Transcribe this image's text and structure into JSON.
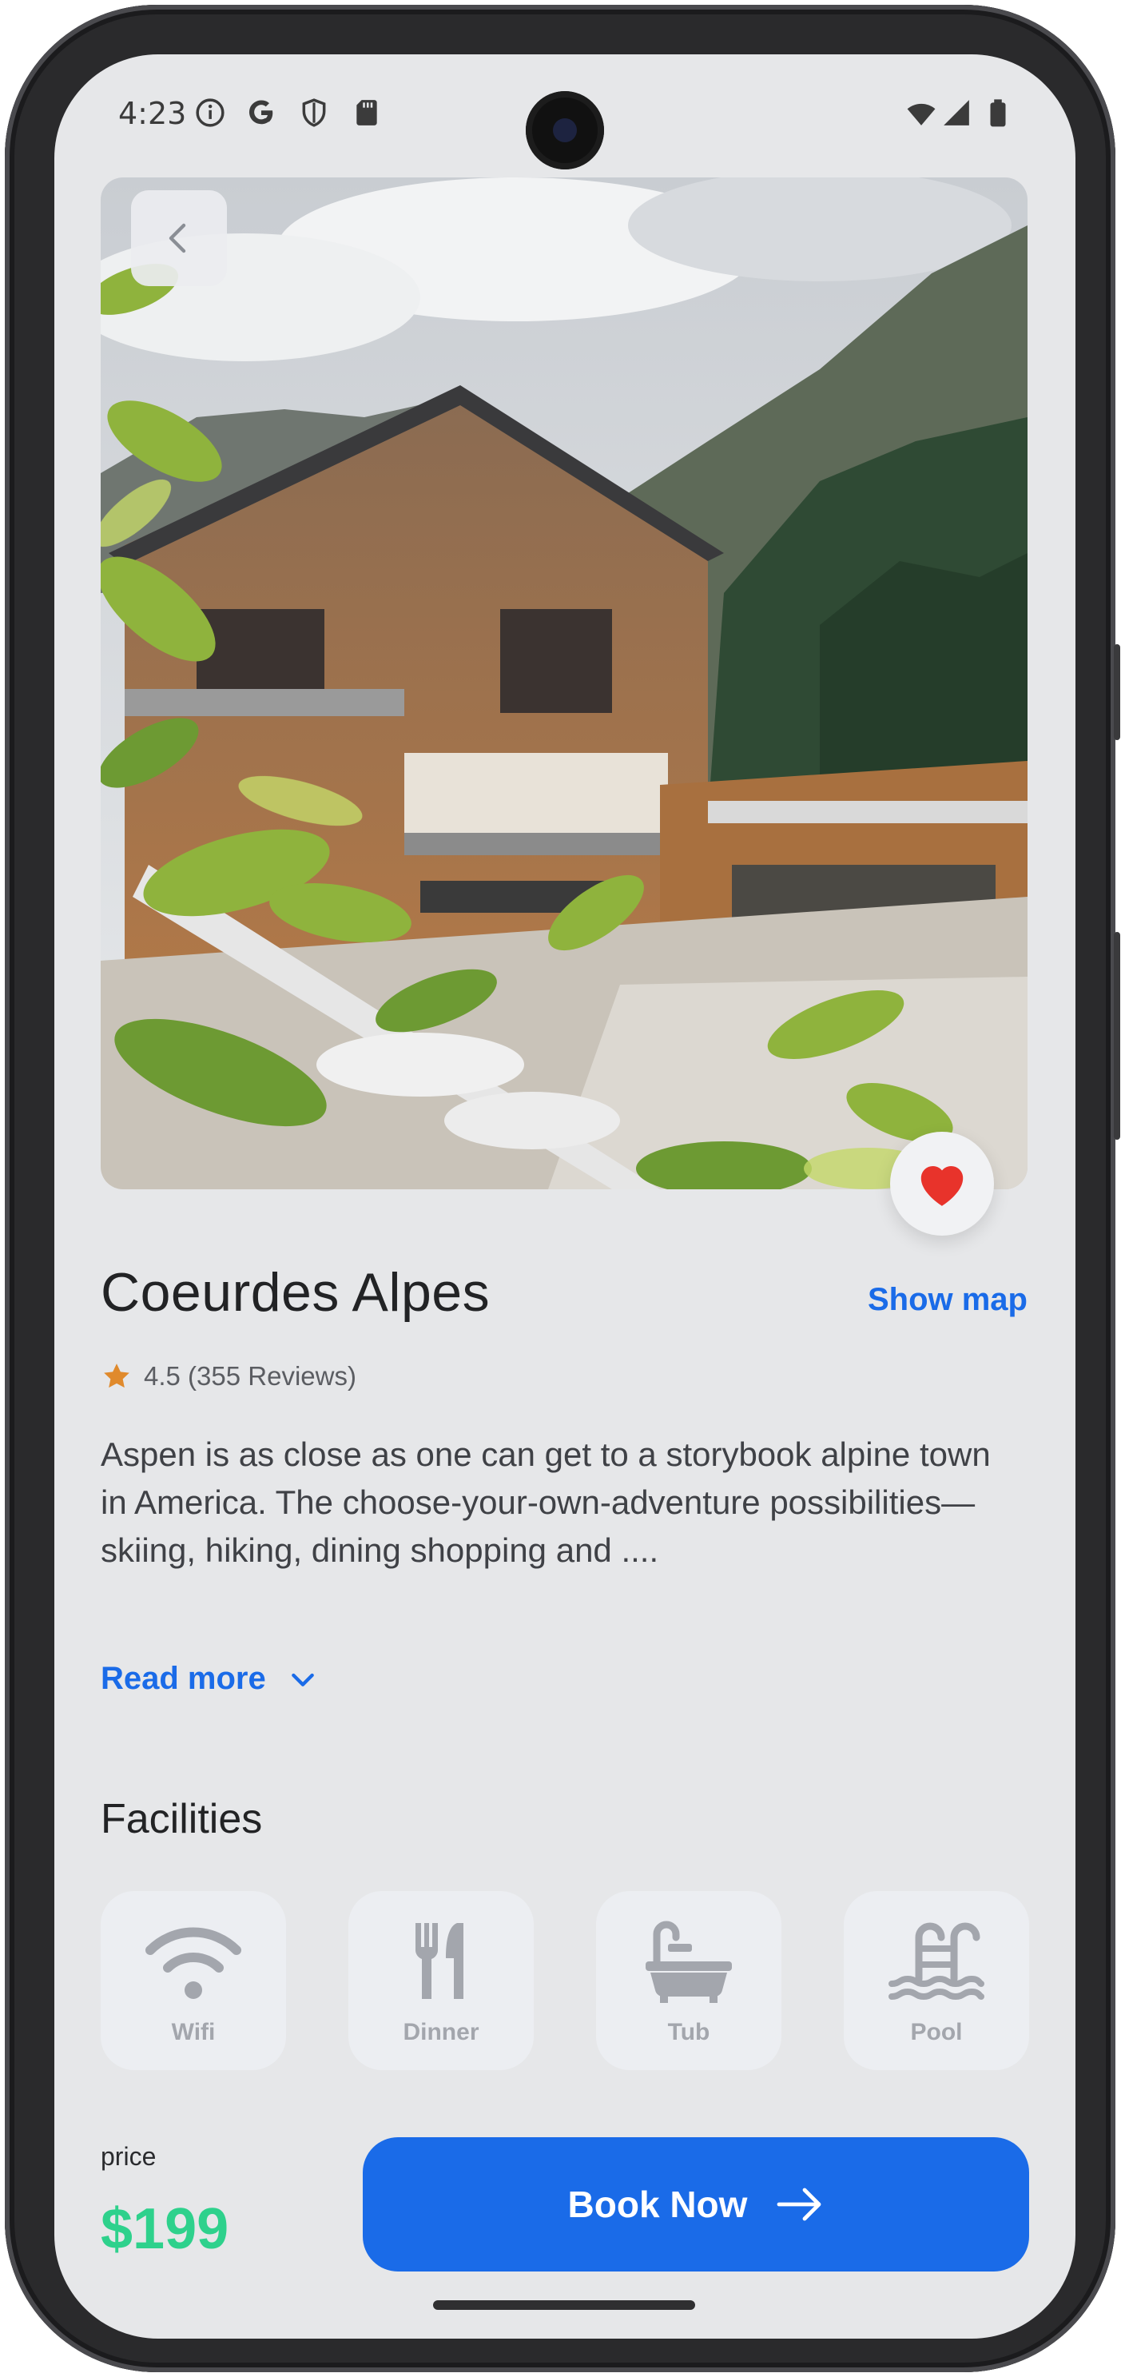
{
  "status_bar": {
    "time": "4:23",
    "left_icons": [
      "info-icon",
      "google-icon",
      "shield-icon",
      "sd-card-icon"
    ],
    "right_icons": [
      "wifi-icon",
      "signal-icon",
      "battery-icon"
    ]
  },
  "hero": {
    "image": "hotel-chalet-photo",
    "back_icon": "chevron-left-icon",
    "favorite_icon": "heart-icon",
    "favorite_color": "#e8332b"
  },
  "hotel": {
    "name": "Coeurdes Alpes",
    "show_map": "Show map",
    "rating_text": "4.5 (355 Reviews)",
    "star_color": "#e08a2c",
    "description": "Aspen is as close as one can get to a storybook alpine town in America. The choose-your-own-adventure possibilities—skiing, hiking, dining shopping and ....",
    "read_more": "Read more"
  },
  "facilities": {
    "title": "Facilities",
    "items": [
      {
        "label": "Wifi",
        "icon": "wifi-icon"
      },
      {
        "label": "Dinner",
        "icon": "fork-knife-icon"
      },
      {
        "label": "Tub",
        "icon": "bathtub-icon"
      },
      {
        "label": "Pool",
        "icon": "pool-icon"
      }
    ]
  },
  "booking": {
    "price_label": "price",
    "price": "$199",
    "button_label": "Book Now",
    "accent": "#1a6be8",
    "price_color": "#2ed18c"
  }
}
